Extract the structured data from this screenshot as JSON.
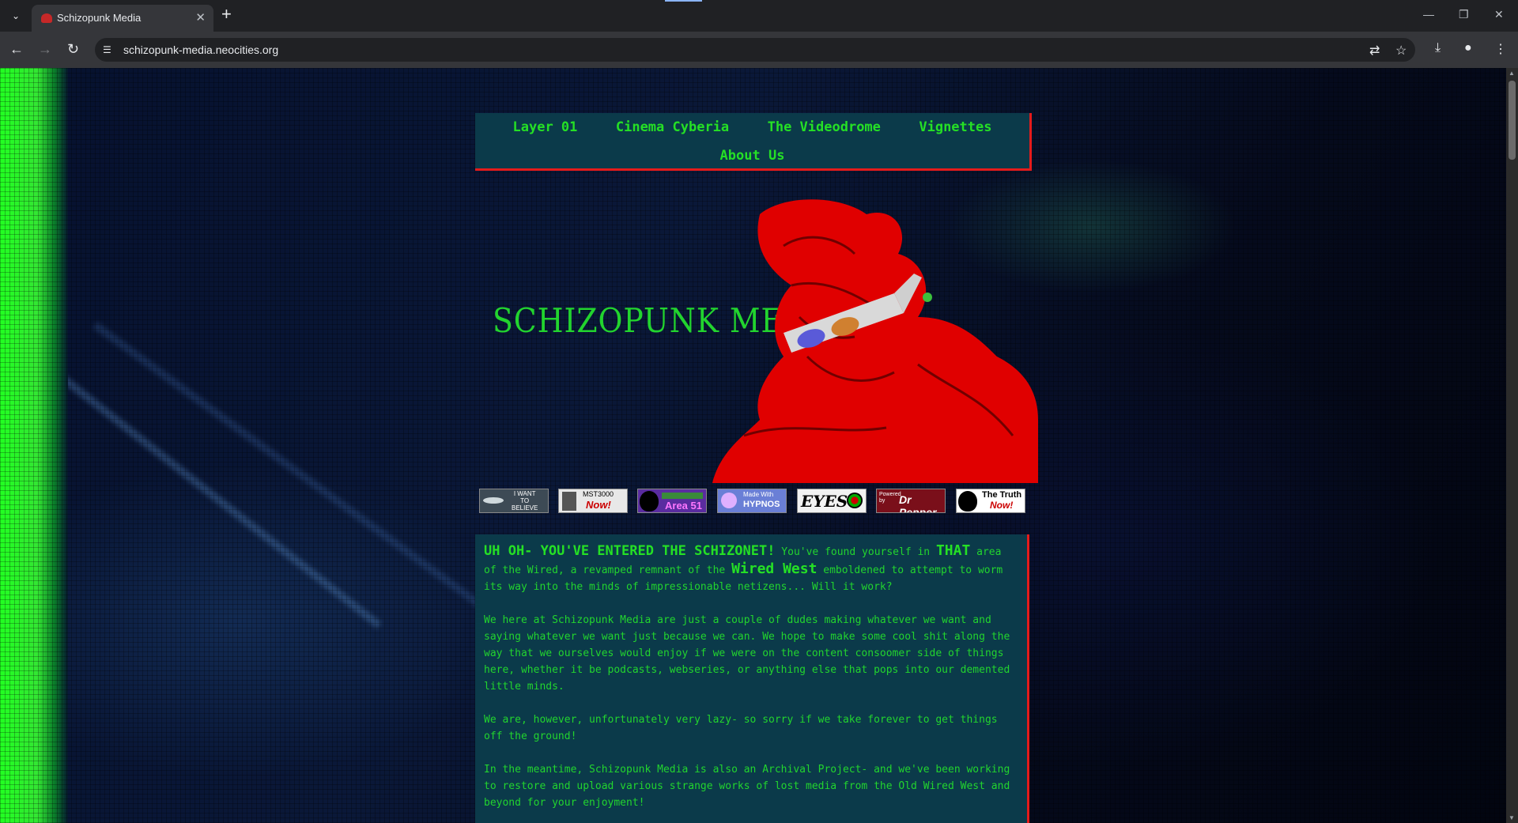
{
  "browser": {
    "tab_title": "Schizopunk Media",
    "url": "schizopunk-media.neocities.org"
  },
  "nav": {
    "items": [
      "Layer 01",
      "Cinema Cyberia",
      "The Videodrome",
      "Vignettes",
      "About Us"
    ]
  },
  "hero": {
    "title": "SCHIZOPUNK MEDIA"
  },
  "badges": [
    {
      "name": "i-want-to-believe-badge",
      "lines": [
        "I WANT",
        "TO",
        "BELIEVE"
      ],
      "bg": "#3d4a55",
      "fg": "#ffffff"
    },
    {
      "name": "mst3000-badge",
      "lines": [
        "MST3000",
        "Now!"
      ],
      "bg": "#e8e8e8",
      "fg": "#cc0000"
    },
    {
      "name": "area-51-badge",
      "lines": [
        "Area 51"
      ],
      "bg": "#5a2ca0",
      "fg": "#ff77ff"
    },
    {
      "name": "hypnos-badge",
      "lines": [
        "Made With",
        "HYPNOS"
      ],
      "bg": "#6a7fd6",
      "fg": "#ffffff"
    },
    {
      "name": "eyes-badge",
      "lines": [
        "EYES"
      ],
      "bg": "#f2f2f2",
      "fg": "#000000"
    },
    {
      "name": "dr-pepper-badge",
      "lines": [
        "Powered by",
        "Dr Pepper"
      ],
      "bg": "#7a0f1a",
      "fg": "#ffffff"
    },
    {
      "name": "the-truth-badge",
      "lines": [
        "The Truth",
        "Now!"
      ],
      "bg": "#ffffff",
      "fg": "#cc0000"
    }
  ],
  "content": {
    "intro_big": "UH OH- YOU'VE ENTERED THE SCHIZONET!",
    "intro_a": " You've found yourself in ",
    "intro_that": "THAT",
    "intro_b": " area of the Wired, a revamped remnant of the ",
    "intro_wired": "Wired West",
    "intro_c": " emboldened to attempt to worm its way into the minds of impressionable netizens... Will it work?",
    "p2": "We here at Schizopunk Media are just a couple of dudes making whatever we want and saying whatever we want just because we can. We hope to make some cool shit along the way that we ourselves would enjoy if we were on the content consoomer side of things here, whether it be podcasts, webseries, or anything else that pops into our demented little minds.",
    "p3": "We are, however, unfortunately very lazy- so sorry if we take forever to get things off the ground!",
    "p4": "In the meantime, Schizopunk Media is also an Archival Project- and we've been working to restore and upload various strange works of lost media from the Old Wired West and beyond for your enjoyment!"
  },
  "colors": {
    "accent_green": "#22d42e",
    "accent_red": "#e51b1b",
    "panel_bg": "#0b3a4a"
  }
}
